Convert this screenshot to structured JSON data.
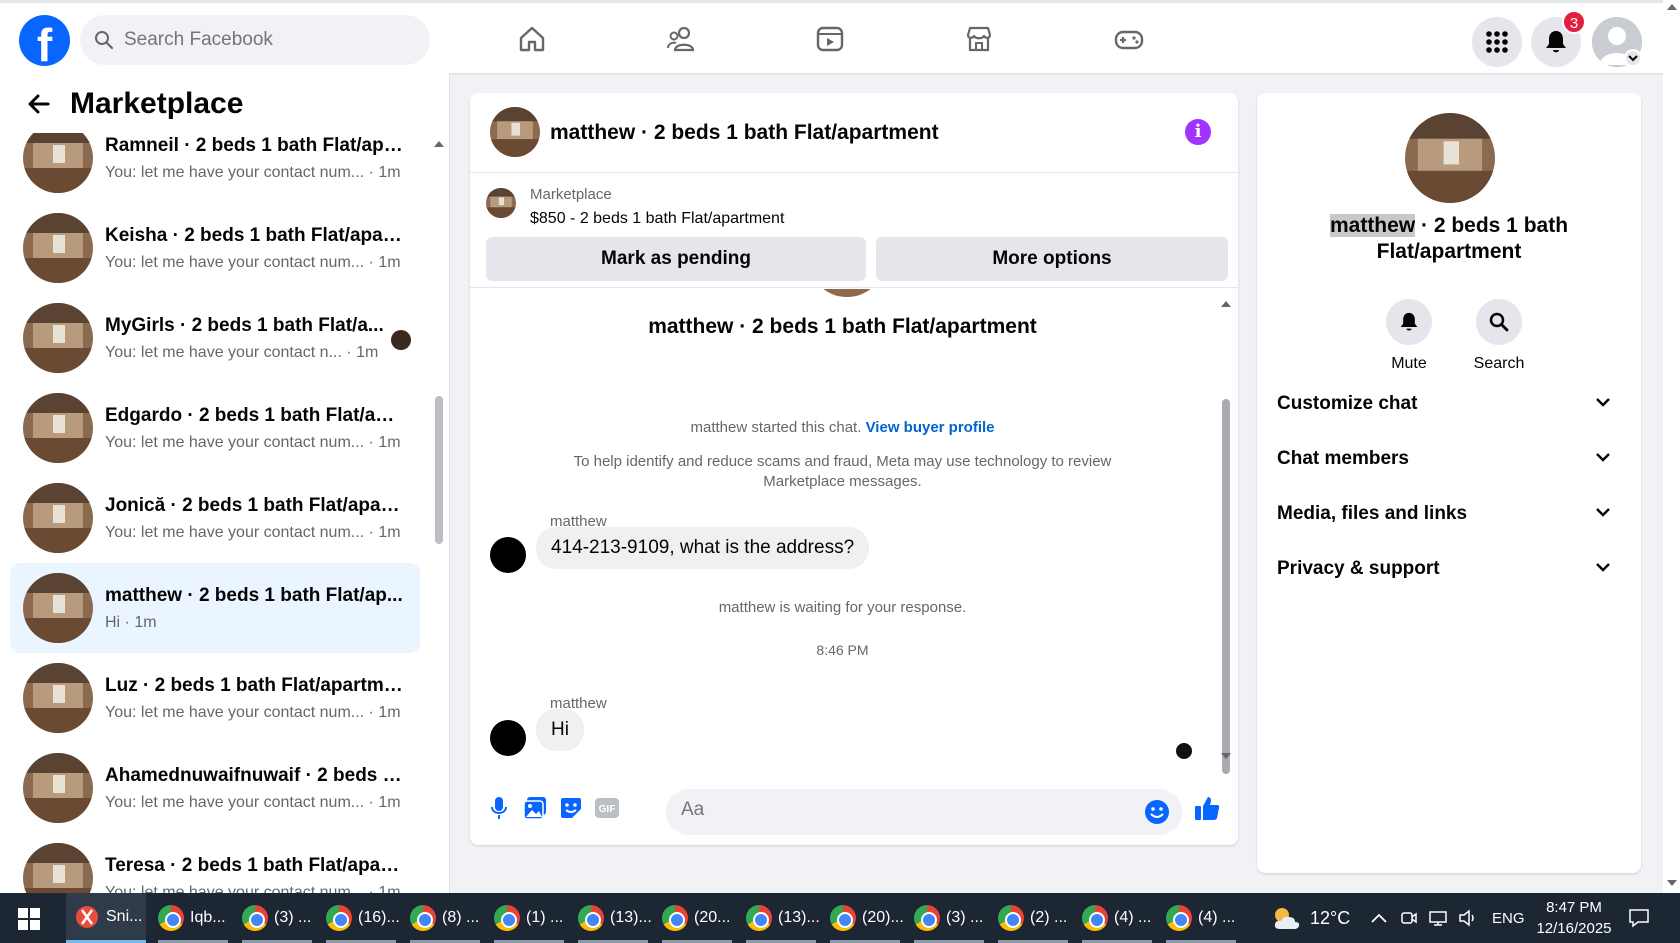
{
  "topbar": {
    "logo": "f",
    "search_placeholder": "Search Facebook",
    "nav_icons": [
      "home-icon",
      "friends-icon",
      "video-icon",
      "marketplace-icon",
      "gaming-icon"
    ],
    "notification_count": "3"
  },
  "sidebar": {
    "title": "Marketplace",
    "conversations": [
      {
        "name": "Ramneil · 2 beds 1 bath Flat/apa...",
        "preview": "You: let me have your contact num... · 1m"
      },
      {
        "name": "Keisha · 2 beds 1 bath Flat/apart...",
        "preview": "You: let me have your contact num... · 1m"
      },
      {
        "name": "MyGirls · 2 beds 1 bath Flat/a...",
        "preview": "You: let me have your contact n... · 1m"
      },
      {
        "name": "Edgardo · 2 beds 1 bath Flat/apa...",
        "preview": "You: let me have your contact num... · 1m"
      },
      {
        "name": "Jonică · 2 beds 1 bath Flat/apart...",
        "preview": "You: let me have your contact num... · 1m"
      },
      {
        "name": "matthew · 2 beds 1 bath Flat/ap...",
        "preview": "Hi · 1m"
      },
      {
        "name": "Luz · 2 beds 1 bath Flat/apartment",
        "preview": "You: let me have your contact num... · 1m"
      },
      {
        "name": "Ahamednuwaifnuwaif · 2 beds 1 ...",
        "preview": "You: let me have your contact num... · 1m"
      },
      {
        "name": "Teresa · 2 beds 1 bath Flat/apart...",
        "preview": "You: let me have your contact num... · 1m"
      }
    ]
  },
  "chat": {
    "title": "matthew · 2 beds 1 bath Flat/apartment",
    "listing_source": "Marketplace",
    "listing_price_title": "$850 - 2 beds 1 bath Flat/apartment",
    "mark_pending_label": "Mark as pending",
    "more_options_label": "More options",
    "intro_title": "matthew · 2 beds 1 bath Flat/apartment",
    "started_text": "matthew started this chat.",
    "view_profile_link": "View buyer profile",
    "scam_notice_line1": "To help identify and reduce scams and fraud, Meta may use technology to review",
    "scam_notice_line2": "Marketplace messages.",
    "messages": [
      {
        "sender": "matthew",
        "text": "414-213-9109, what is the address?"
      },
      {
        "sender": "matthew",
        "text": "Hi"
      }
    ],
    "waiting_text": "matthew is waiting for your response.",
    "timestamp": "8:46 PM",
    "composer_placeholder": "Aa"
  },
  "details": {
    "name_highlight": "matthew",
    "title_rest": " · 2 beds 1 bath",
    "title_line2": "Flat/apartment",
    "actions": [
      {
        "label": "Mute"
      },
      {
        "label": "Search"
      }
    ],
    "sections": [
      {
        "label": "Customize chat"
      },
      {
        "label": "Chat members"
      },
      {
        "label": "Media, files and links"
      },
      {
        "label": "Privacy & support"
      }
    ]
  },
  "taskbar": {
    "items": [
      {
        "label": "Sni..."
      },
      {
        "label": "Iqb..."
      },
      {
        "label": "(3) ..."
      },
      {
        "label": "(16)..."
      },
      {
        "label": "(8) ..."
      },
      {
        "label": "(1) ..."
      },
      {
        "label": "(13)..."
      },
      {
        "label": "(20..."
      },
      {
        "label": "(13)..."
      },
      {
        "label": "(20)..."
      },
      {
        "label": "(3) ..."
      },
      {
        "label": "(2) ..."
      },
      {
        "label": "(4) ..."
      },
      {
        "label": "(4) ..."
      }
    ],
    "temperature": "12°C",
    "language": "ENG",
    "time": "8:47 PM",
    "date": "12/16/2025"
  },
  "colors": {
    "brand_blue": "#0866ff",
    "link_blue": "#0064d1",
    "active_conv_bg": "#ebf5ff",
    "info_purple": "#a033ff",
    "badge_red": "#e41e3f"
  }
}
